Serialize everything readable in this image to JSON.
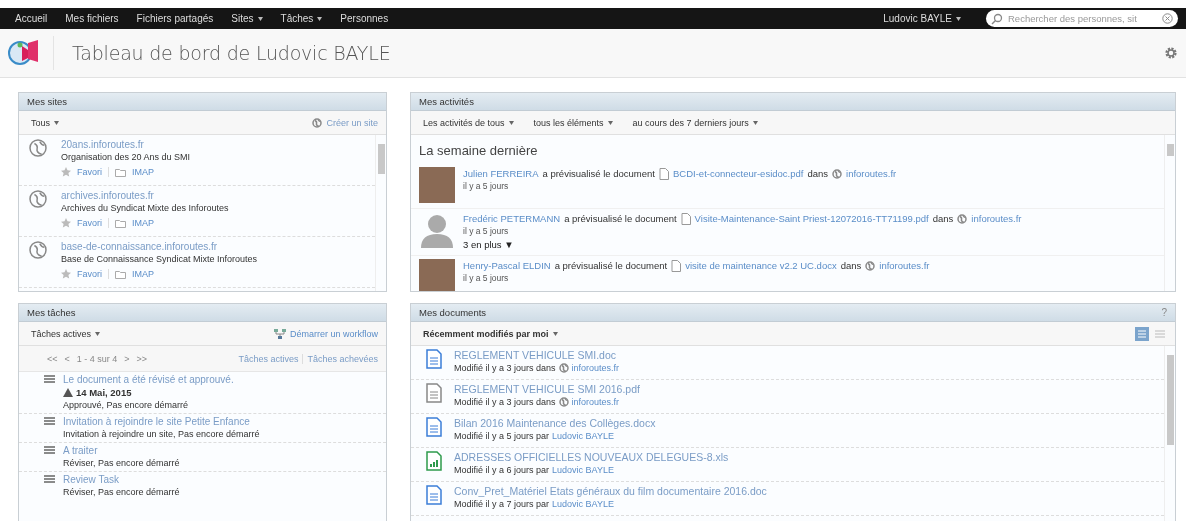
{
  "top_nav": {
    "items": [
      {
        "label": "Accueil",
        "has_menu": false
      },
      {
        "label": "Mes fichiers",
        "has_menu": false
      },
      {
        "label": "Fichiers partagés",
        "has_menu": false
      },
      {
        "label": "Sites",
        "has_menu": true
      },
      {
        "label": "Tâches",
        "has_menu": true
      },
      {
        "label": "Personnes",
        "has_menu": false
      }
    ],
    "user": "Ludovic BAYLE",
    "search": {
      "placeholder": "Rechercher des personnes, sit"
    }
  },
  "header": {
    "title": "Tableau de bord de Ludovic BAYLE"
  },
  "my_sites": {
    "title": "Mes sites",
    "filter": "Tous",
    "create_link": "Créer un site",
    "sites": [
      {
        "name": "20ans.inforoutes.fr",
        "description": "Organisation des 20 Ans du SMI",
        "favorite": "Favori",
        "imap": "IMAP"
      },
      {
        "name": "archives.inforoutes.fr",
        "description": "Archives du Syndicat Mixte des Inforoutes",
        "favorite": "Favori",
        "imap": "IMAP"
      },
      {
        "name": "base-de-connaissance.inforoutes.fr",
        "description": "Base de Connaissance Syndicat Mixte Inforoutes",
        "favorite": "Favori",
        "imap": "IMAP"
      }
    ]
  },
  "my_activities": {
    "title": "Mes activités",
    "filters": [
      "Les activités de tous",
      "tous les éléments",
      "au cours des 7 derniers jours"
    ],
    "section": "La semaine dernière",
    "items": [
      {
        "kind": "photo",
        "person": "Julien FERREIRA",
        "action": "a prévisualisé le document",
        "document": "BCDI-et-connecteur-esidoc.pdf",
        "in": "dans",
        "site": "inforoutes.fr",
        "time": "il y a 5 jours"
      },
      {
        "kind": "silhouette",
        "person": "Fredéric PETERMANN",
        "action": "a prévisualisé le document",
        "document": "Visite-Maintenance-Saint Priest-12072016-TT71199.pdf",
        "in": "dans",
        "site": "inforoutes.fr",
        "time": "il y a 5 jours",
        "more": "3 en plus ▼"
      },
      {
        "kind": "photo",
        "person": "Henry-Pascal ELDIN",
        "action": "a prévisualisé le document",
        "document": "visite de maintenance v2.2 UC.docx",
        "in": "dans",
        "site": "inforoutes.fr",
        "time": "il y a 5 jours"
      }
    ]
  },
  "my_tasks": {
    "title": "Mes tâches",
    "filter": "Tâches actives",
    "workflow_link": "Démarrer un workflow",
    "pager": {
      "first": "<<",
      "prev": "<",
      "range": "1 - 4 sur 4",
      "next": ">",
      "last": ">>"
    },
    "views": [
      "Tâches actives",
      "Tâches achevées"
    ],
    "tasks": [
      {
        "title": "Le document a été révisé et approuvé.",
        "due": "14 Mai, 2015",
        "status": "Approuvé, Pas encore démarré"
      },
      {
        "title": "Invitation à rejoindre le site Petite Enfance",
        "status": "Invitation à rejoindre un site, Pas encore démarré"
      },
      {
        "title": "A traiter",
        "status": "Réviser, Pas encore démarré"
      },
      {
        "title": "Review Task",
        "status": "Réviser, Pas encore démarré"
      }
    ]
  },
  "my_documents": {
    "title": "Mes documents",
    "help": "?",
    "filter": "Récemment modifiés par moi",
    "view_modes": [
      {
        "kind": "detailed",
        "selected": true
      },
      {
        "kind": "simple",
        "selected": false
      }
    ],
    "documents": [
      {
        "kind": "doc",
        "name": "REGLEMENT VEHICULE SMI.doc",
        "meta": "Modifié il y a 3 jours dans",
        "site": "inforoutes.fr"
      },
      {
        "kind": "pdf",
        "name": "REGLEMENT VEHICULE SMI 2016.pdf",
        "meta": "Modifié il y a 3 jours dans",
        "site": "inforoutes.fr"
      },
      {
        "kind": "doc",
        "name": "Bilan 2016 Maintenance des Collèges.docx",
        "meta": "Modifié il y a 5 jours par",
        "author": "Ludovic BAYLE"
      },
      {
        "kind": "xls",
        "name": "ADRESSES OFFICIELLES NOUVEAUX DELEGUES-8.xls",
        "meta": "Modifié il y a 6 jours par",
        "author": "Ludovic BAYLE"
      },
      {
        "kind": "doc",
        "name": "Conv_Pret_Matériel Etats généraux du film documentaire 2016.doc",
        "meta": "Modifié il y a 7 jours par",
        "author": "Ludovic BAYLE"
      }
    ]
  }
}
